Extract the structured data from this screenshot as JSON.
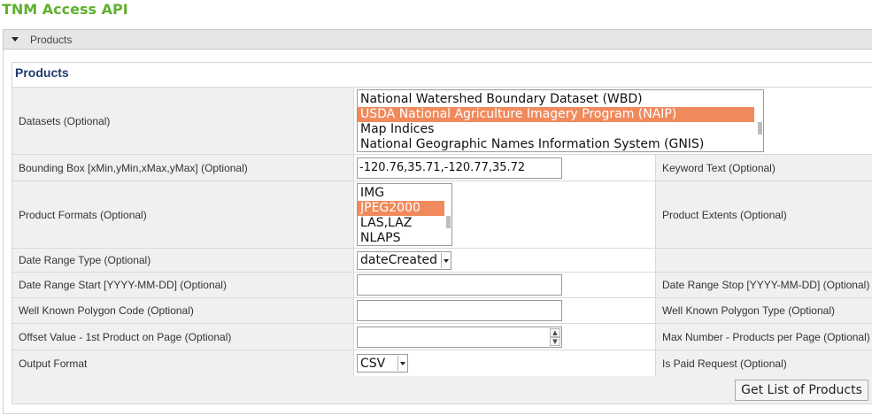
{
  "app": {
    "title": "TNM Access API"
  },
  "section": {
    "label": "Products"
  },
  "form": {
    "title": "Products",
    "datasets": {
      "label": "Datasets (Optional)",
      "options": [
        "National Watershed Boundary Dataset (WBD)",
        "USDA National Agriculture Imagery Program (NAIP)",
        "Map Indices",
        "National Geographic Names Information System (GNIS)"
      ],
      "selected": "USDA National Agriculture Imagery Program (NAIP)"
    },
    "bbox": {
      "label": "Bounding Box [xMin,yMin,xMax,yMax] (Optional)",
      "value": "-120.76,35.71,-120.77,35.72"
    },
    "keyword": {
      "label": "Keyword Text (Optional)"
    },
    "formats": {
      "label": "Product Formats (Optional)",
      "options": [
        "IMG",
        "JPEG2000",
        "LAS,LAZ",
        "NLAPS"
      ],
      "selected": "JPEG2000"
    },
    "extents": {
      "label": "Product Extents (Optional)"
    },
    "date_type": {
      "label": "Date Range Type (Optional)",
      "value": "dateCreated"
    },
    "date_start": {
      "label": "Date Range Start [YYYY-MM-DD] (Optional)",
      "value": ""
    },
    "date_stop": {
      "label": "Date Range Stop [YYYY-MM-DD] (Optional)"
    },
    "polygon_code": {
      "label": "Well Known Polygon Code (Optional)",
      "value": ""
    },
    "polygon_type": {
      "label": "Well Known Polygon Type (Optional)"
    },
    "offset": {
      "label": "Offset Value - 1st Product on Page (Optional)",
      "value": ""
    },
    "max_number": {
      "label": "Max Number - Products per Page (Optional)"
    },
    "output_format": {
      "label": "Output Format",
      "value": "CSV"
    },
    "paid_request": {
      "label": "Is Paid Request (Optional)"
    },
    "submit_label": "Get List of Products"
  },
  "colors": {
    "title_green": "#5fb030",
    "selection": "#f08a5d",
    "form_title": "#1f3c6b"
  }
}
